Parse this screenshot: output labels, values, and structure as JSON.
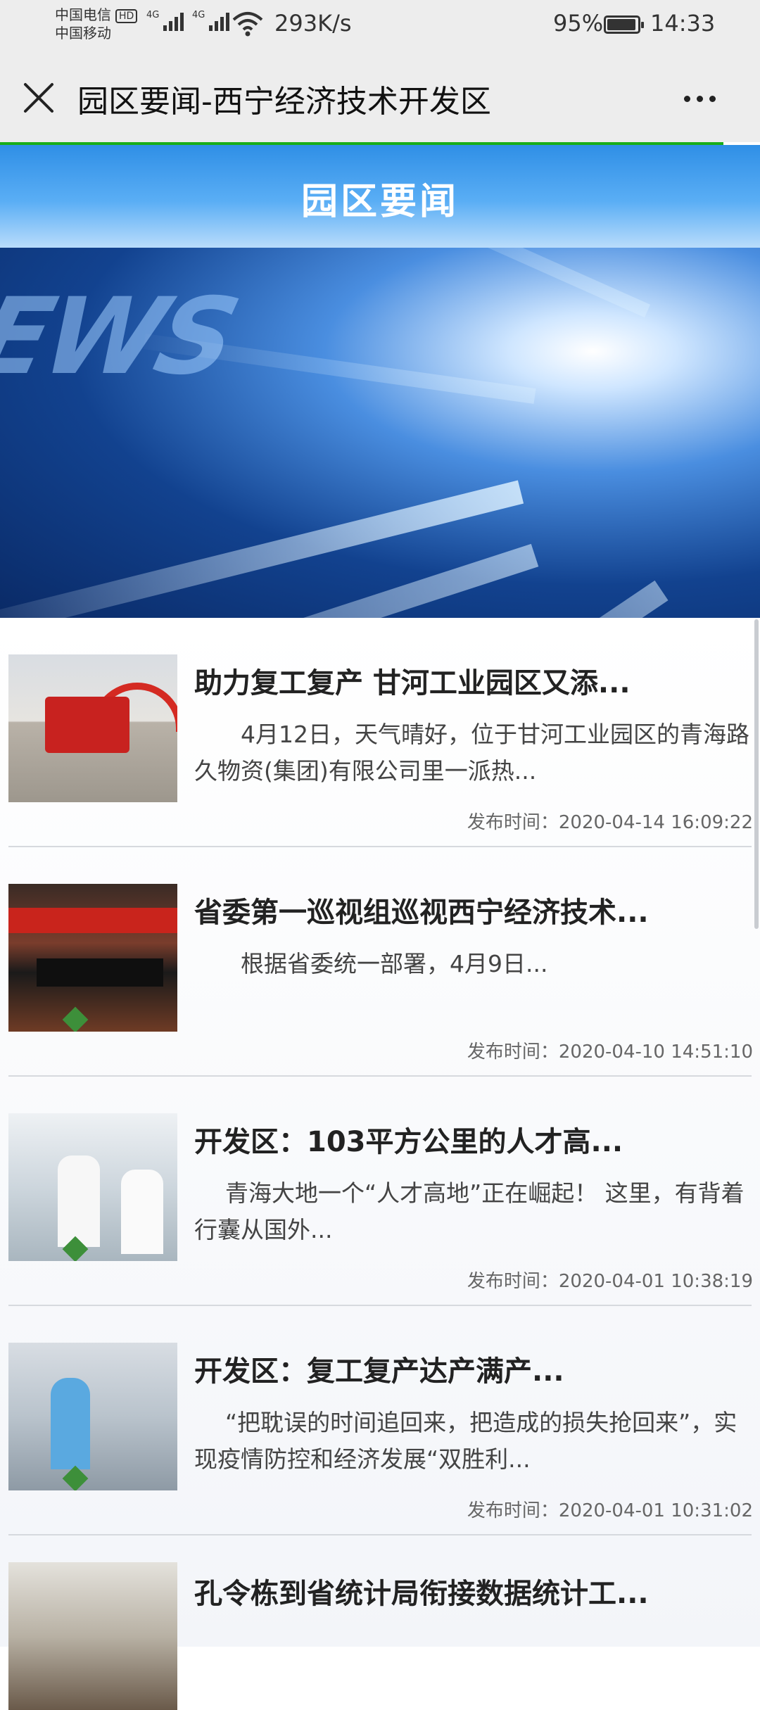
{
  "status_bar": {
    "carrier_1": "中国电信",
    "hd_badge": "HD",
    "carrier_2": "中国移动",
    "network_1": "4G",
    "network_2": "4G",
    "speed": "293K/s",
    "battery_pct": "95%",
    "battery_level": 0.95,
    "time": "14:33"
  },
  "titlebar": {
    "title": "园区要闻-西宁经济技术开发区",
    "close_icon": "close-icon",
    "more_icon": "more-icon"
  },
  "page": {
    "header": "园区要闻",
    "accent_color": "#2f8fe6",
    "progress_color": "#1aad19",
    "banner_icon": "news-banner-image"
  },
  "news": [
    {
      "title": "助力复工复产 甘河工业园区又添...",
      "desc": "4月12日，天气晴好，位于甘河工业园区的青海路久物资(集团)有限公司里一派热...",
      "time": "发布时间：2020-04-14 16:09:22"
    },
    {
      "title": "省委第一巡视组巡视西宁经济技术...",
      "desc": "根据省委统一部署，4月9日...",
      "time": "发布时间：2020-04-10 14:51:10"
    },
    {
      "title": "开发区：103平方公里的人才高...",
      "desc": "青海大地一个“人才高地”正在崛起！ 这里，有背着行囊从国外...",
      "time": "发布时间：2020-04-01 10:38:19"
    },
    {
      "title": "开发区：复工复产达产满产...",
      "desc": "“把耽误的时间追回来，把造成的损失抢回来”，实现疫情防控和经济发展“双胜利...",
      "time": "发布时间：2020-04-01 10:31:02"
    },
    {
      "title": "孔令栋到省统计局衔接数据统计工...",
      "desc": "",
      "time": ""
    }
  ]
}
